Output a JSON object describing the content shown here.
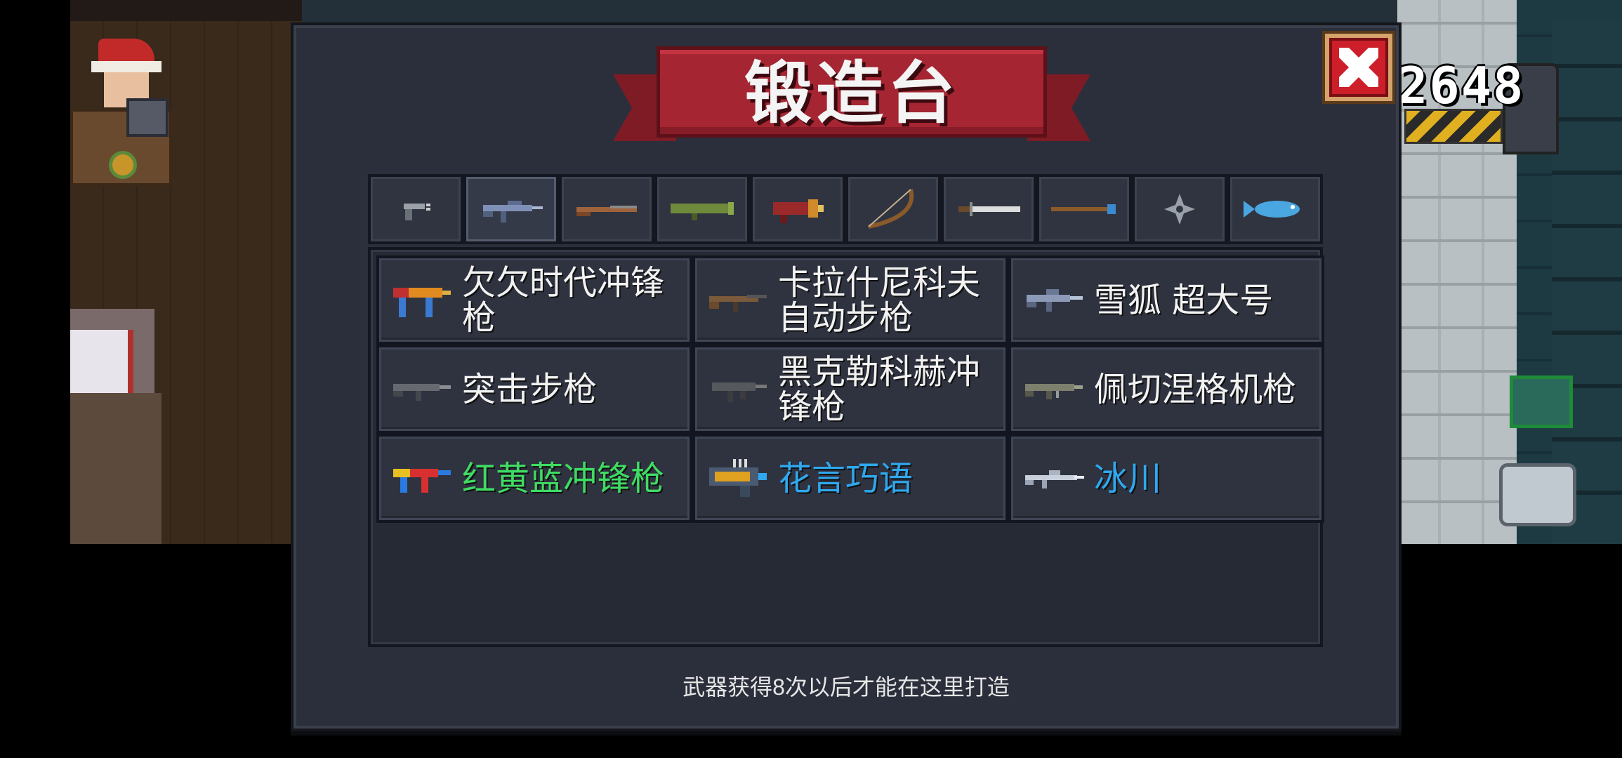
{
  "header": {
    "title": "锻造台",
    "score": "2648"
  },
  "close_button": {
    "label": "X",
    "icon": "close-icon"
  },
  "tabs": [
    {
      "icon": "pistol-icon",
      "active": false
    },
    {
      "icon": "rifle-icon",
      "active": true
    },
    {
      "icon": "shotgun-icon",
      "active": false
    },
    {
      "icon": "launcher-icon",
      "active": false
    },
    {
      "icon": "blaster-icon",
      "active": false
    },
    {
      "icon": "bow-icon",
      "active": false
    },
    {
      "icon": "sword-icon",
      "active": false
    },
    {
      "icon": "staff-icon",
      "active": false
    },
    {
      "icon": "shuriken-icon",
      "active": false
    },
    {
      "icon": "fish-icon",
      "active": false
    }
  ],
  "weapons": [
    {
      "name": "欠欠时代冲锋枪",
      "icon": "smg-icon",
      "color": "#f2f2f2"
    },
    {
      "name": "卡拉什尼科夫自动步枪",
      "icon": "ak-icon",
      "color": "#f2f2f2"
    },
    {
      "name": "雪狐 超大号",
      "icon": "snowfox-icon",
      "color": "#f2f2f2"
    },
    {
      "name": "突击步枪",
      "icon": "assault-rifle-icon",
      "color": "#f2f2f2"
    },
    {
      "name": "黑克勒科赫冲锋枪",
      "icon": "hk-smg-icon",
      "color": "#f2f2f2"
    },
    {
      "name": "佩切涅格机枪",
      "icon": "machine-gun-icon",
      "color": "#f2f2f2"
    },
    {
      "name": "红黄蓝冲锋枪",
      "icon": "rgb-smg-icon",
      "color": "#3fdc63"
    },
    {
      "name": "花言巧语",
      "icon": "sweet-talk-icon",
      "color": "#2fa8ef"
    },
    {
      "name": "冰川",
      "icon": "glacier-icon",
      "color": "#2fa8ef"
    }
  ],
  "footer": {
    "note": "武器获得8次以后才能在这里打造"
  },
  "colors": {
    "panel": "#2b2f3b",
    "ribbon": "#a52632",
    "rare_green": "#3fdc63",
    "rare_blue": "#2fa8ef"
  }
}
